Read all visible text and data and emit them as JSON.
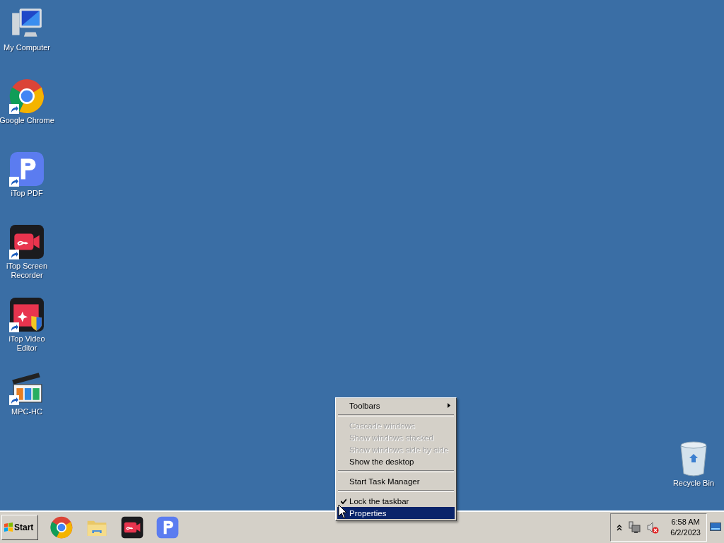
{
  "desktop_icons": [
    {
      "kind": "computer",
      "label": "My Computer",
      "shortcut": false
    },
    {
      "kind": "chrome",
      "label": "Google Chrome",
      "shortcut": true
    },
    {
      "kind": "pdf",
      "label": "iTop PDF",
      "shortcut": true
    },
    {
      "kind": "recorder",
      "label": "iTop Screen Recorder",
      "shortcut": true
    },
    {
      "kind": "video-editor",
      "label": "iTop Video Editor",
      "shortcut": true
    },
    {
      "kind": "mpc",
      "label": "MPC-HC",
      "shortcut": true
    }
  ],
  "recycle_bin": {
    "label": "Recycle Bin"
  },
  "context_menu": {
    "items": [
      {
        "kind": "item",
        "label": "Toolbars",
        "disabled": false,
        "checked": false,
        "selected": false,
        "submenu": true
      },
      {
        "kind": "separator"
      },
      {
        "kind": "item",
        "label": "Cascade windows",
        "disabled": true,
        "checked": false,
        "selected": false,
        "submenu": false
      },
      {
        "kind": "item",
        "label": "Show windows stacked",
        "disabled": true,
        "checked": false,
        "selected": false,
        "submenu": false
      },
      {
        "kind": "item",
        "label": "Show windows side by side",
        "disabled": true,
        "checked": false,
        "selected": false,
        "submenu": false
      },
      {
        "kind": "item",
        "label": "Show the desktop",
        "disabled": false,
        "checked": false,
        "selected": false,
        "submenu": false
      },
      {
        "kind": "separator"
      },
      {
        "kind": "item",
        "label": "Start Task Manager",
        "disabled": false,
        "checked": false,
        "selected": false,
        "submenu": false
      },
      {
        "kind": "separator"
      },
      {
        "kind": "item",
        "label": "Lock the taskbar",
        "disabled": false,
        "checked": true,
        "selected": false,
        "submenu": false
      },
      {
        "kind": "item",
        "label": "Properties",
        "disabled": false,
        "checked": false,
        "selected": true,
        "submenu": false
      }
    ]
  },
  "taskbar": {
    "start_label": "Start",
    "pinned": [
      {
        "kind": "chrome"
      },
      {
        "kind": "folder"
      },
      {
        "kind": "recorder"
      },
      {
        "kind": "pdf"
      }
    ],
    "tray": {
      "time": "6:58 AM",
      "date": "6/2/2023",
      "volume_muted": true
    }
  }
}
